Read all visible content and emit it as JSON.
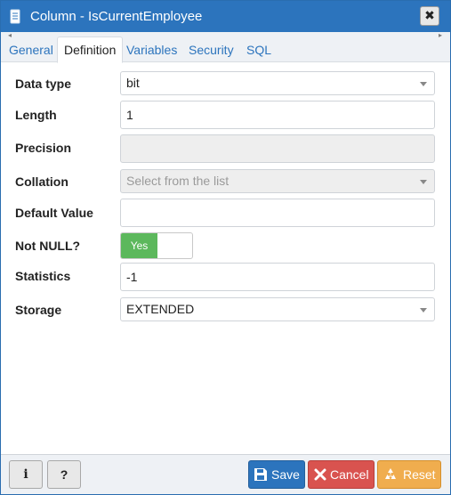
{
  "window": {
    "title": "Column - IsCurrentEmployee",
    "icon": "column-icon",
    "close_label": "✖"
  },
  "tabs": [
    {
      "label": "General",
      "active": false
    },
    {
      "label": "Definition",
      "active": true
    },
    {
      "label": "Variables",
      "active": false
    },
    {
      "label": "Security",
      "active": false
    },
    {
      "label": "SQL",
      "active": false
    }
  ],
  "form": {
    "data_type": {
      "label": "Data type",
      "value": "bit"
    },
    "length": {
      "label": "Length",
      "value": "1"
    },
    "precision": {
      "label": "Precision",
      "value": ""
    },
    "collation": {
      "label": "Collation",
      "placeholder": "Select from the list"
    },
    "default_value": {
      "label": "Default Value",
      "value": ""
    },
    "not_null": {
      "label": "Not NULL?",
      "value": "Yes"
    },
    "statistics": {
      "label": "Statistics",
      "value": "-1"
    },
    "storage": {
      "label": "Storage",
      "value": "EXTENDED"
    }
  },
  "footer": {
    "info_label": "i",
    "help_label": "?",
    "save_label": "Save",
    "cancel_label": "Cancel",
    "reset_label": "Reset"
  },
  "colors": {
    "titlebar": "#2c74bd",
    "save": "#2c74bd",
    "cancel": "#d9534f",
    "reset": "#f0ad4e",
    "toggle_on": "#5cb85c"
  }
}
